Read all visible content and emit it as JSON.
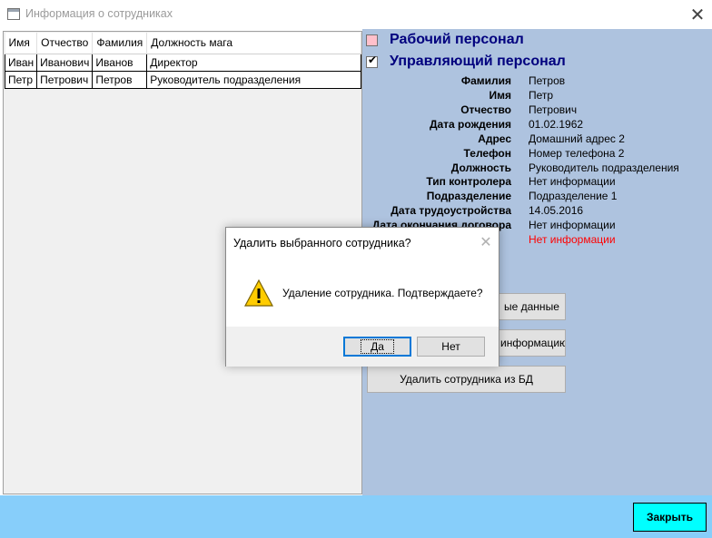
{
  "window": {
    "title": "Информация о сотрудниках",
    "close_glyph": "✕"
  },
  "grid": {
    "columns": [
      "Имя",
      "Отчество",
      "Фамилия",
      "Должность мага"
    ],
    "rows": [
      [
        "Иван",
        "Иванович",
        "Иванов",
        "Директор"
      ],
      [
        "Петр",
        "Петрович",
        "Петров",
        "Руководитель подразделения"
      ]
    ]
  },
  "panel": {
    "background": "#aec3df",
    "checkbox_working": {
      "label": "Рабочий персонал",
      "checked": false
    },
    "checkbox_management": {
      "label": "Управляющий персонал",
      "checked": true
    },
    "fields": [
      {
        "label": "Фамилия",
        "value": "Петров"
      },
      {
        "label": "Имя",
        "value": "Петр"
      },
      {
        "label": "Отчество",
        "value": "Петрович"
      },
      {
        "label": "Дата рождения",
        "value": "01.02.1962"
      },
      {
        "label": "Адрес",
        "value": "Домашний адрес 2"
      },
      {
        "label": "Телефон",
        "value": "Номер телефона 2"
      },
      {
        "label": "Должность",
        "value": "Руководитель подразделения"
      },
      {
        "label": "Тип контролера",
        "value": "Нет информации"
      },
      {
        "label": "Подразделение",
        "value": "Подразделение 1"
      },
      {
        "label": "Дата трудоустройства",
        "value": "14.05.2016"
      },
      {
        "label": "Дата окончания договора",
        "value": "Нет информации"
      },
      {
        "label": "",
        "value": "Нет информации"
      }
    ],
    "buttons": {
      "edit_partial": "ые данные",
      "info_partial": "информацию",
      "delete": "Удалить сотрудника из БД"
    }
  },
  "footer": {
    "background": "#87cefa",
    "close_label": "Закрыть",
    "close_color": "#00ffff"
  },
  "dialog": {
    "title": "Удалить выбранного сотрудника?",
    "close_glyph": "✕",
    "icon": "warning-icon",
    "message": "Удаление сотрудника. Подтверждаете?",
    "yes_label": "Да",
    "no_label": "Нет"
  }
}
